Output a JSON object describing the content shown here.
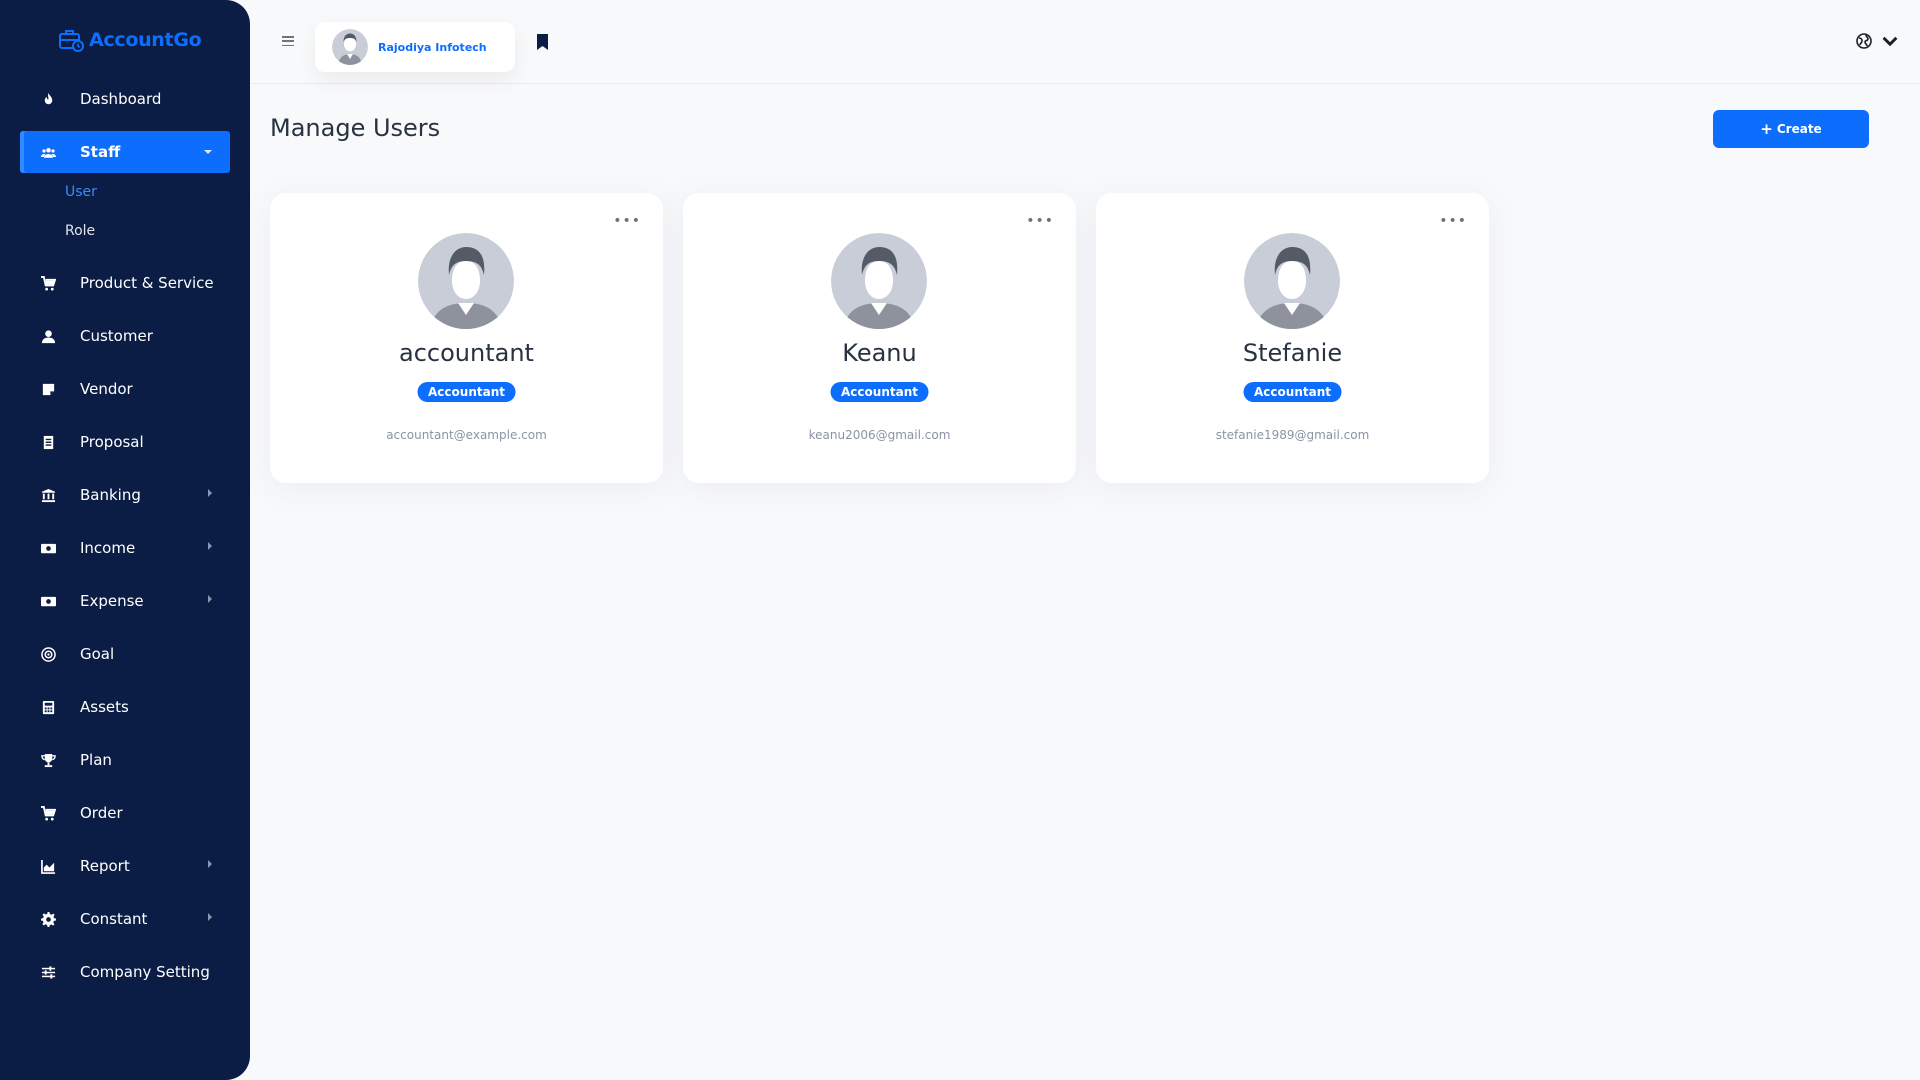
{
  "brand": {
    "name": "AccountGo"
  },
  "sidebar": {
    "items": [
      {
        "label": "Dashboard",
        "icon": "fire-icon",
        "has_arrow": false
      },
      {
        "label": "Staff",
        "icon": "users-icon",
        "has_arrow": true,
        "active": true
      },
      {
        "label": "Product & Service",
        "icon": "cart-icon",
        "has_arrow": false
      },
      {
        "label": "Customer",
        "icon": "customer-icon",
        "has_arrow": false
      },
      {
        "label": "Vendor",
        "icon": "note-icon",
        "has_arrow": false
      },
      {
        "label": "Proposal",
        "icon": "document-icon",
        "has_arrow": false
      },
      {
        "label": "Banking",
        "icon": "bank-icon",
        "has_arrow": true
      },
      {
        "label": "Income",
        "icon": "money-icon",
        "has_arrow": true
      },
      {
        "label": "Expense",
        "icon": "money-icon",
        "has_arrow": true
      },
      {
        "label": "Goal",
        "icon": "target-icon",
        "has_arrow": false
      },
      {
        "label": "Assets",
        "icon": "calculator-icon",
        "has_arrow": false
      },
      {
        "label": "Plan",
        "icon": "trophy-icon",
        "has_arrow": false
      },
      {
        "label": "Order",
        "icon": "cart-icon",
        "has_arrow": false
      },
      {
        "label": "Report",
        "icon": "chart-icon",
        "has_arrow": true
      },
      {
        "label": "Constant",
        "icon": "gear-icon",
        "has_arrow": true
      },
      {
        "label": "Company Setting",
        "icon": "sliders-icon",
        "has_arrow": false
      }
    ],
    "staff_sub": [
      {
        "label": "User",
        "active": true
      },
      {
        "label": "Role",
        "active": false
      }
    ]
  },
  "header": {
    "company_name": "Rajodiya Infotech"
  },
  "main": {
    "title": "Manage Users",
    "create_label": "Create",
    "users": [
      {
        "name": "accountant",
        "role": "Accountant",
        "email": "accountant@example.com"
      },
      {
        "name": "Keanu",
        "role": "Accountant",
        "email": "keanu2006@gmail.com"
      },
      {
        "name": "Stefanie",
        "role": "Accountant",
        "email": "stefanie1989@gmail.com"
      }
    ],
    "more_label": "•••"
  },
  "colors": {
    "sidebar_bg": "#0b1d44",
    "primary": "#0d6efd",
    "page_bg": "#f8f9fa"
  }
}
